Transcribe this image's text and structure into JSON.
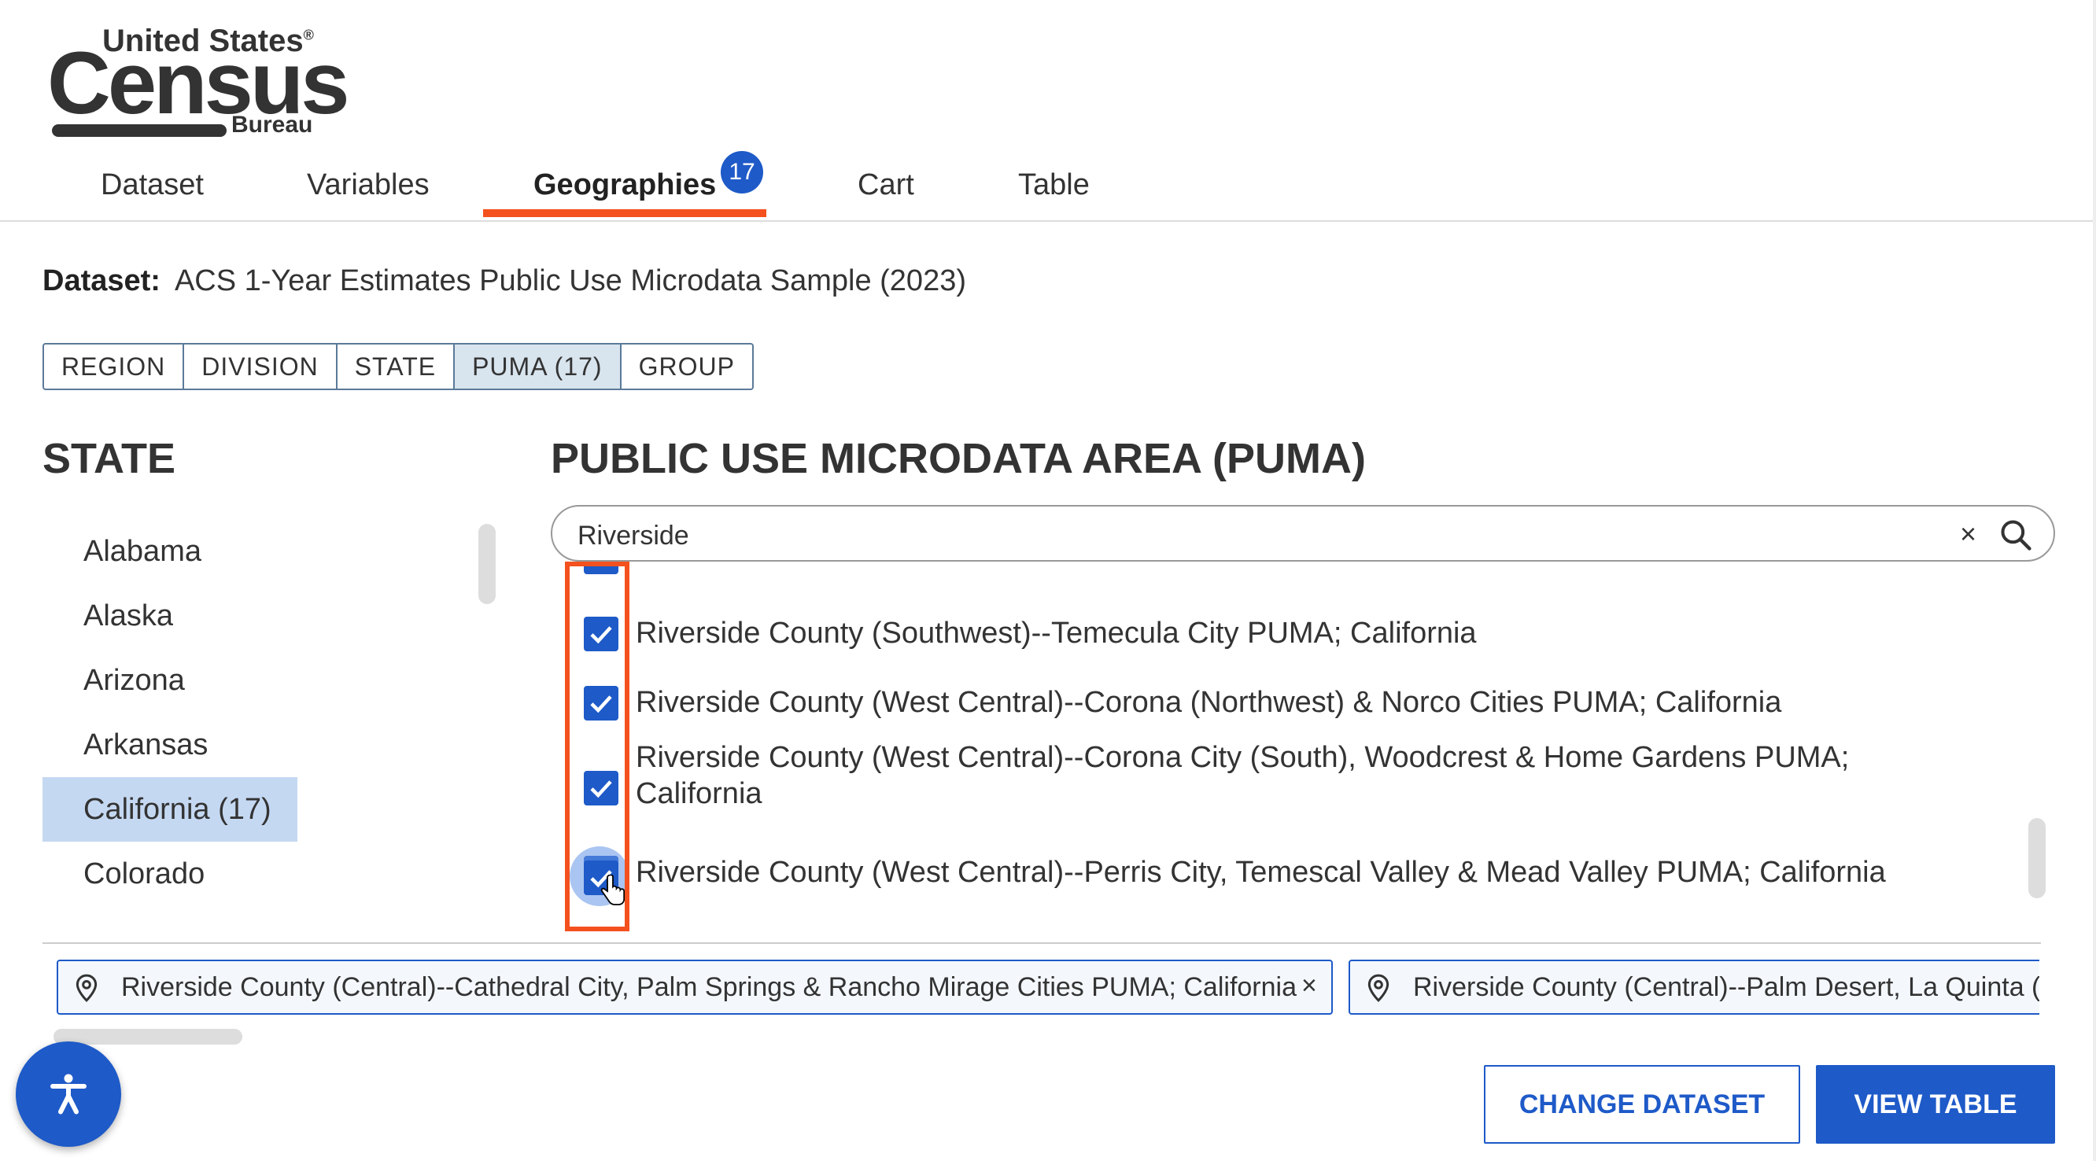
{
  "logo": {
    "line1": "United States",
    "line2": "Census",
    "line3": "Bureau",
    "reg": "®"
  },
  "tabs": [
    {
      "label": "Dataset"
    },
    {
      "label": "Variables"
    },
    {
      "label": "Geographies",
      "badge": "17",
      "active": true
    },
    {
      "label": "Cart"
    },
    {
      "label": "Table"
    }
  ],
  "dataset": {
    "label": "Dataset:",
    "value": "ACS 1-Year Estimates Public Use Microdata Sample (2023)"
  },
  "geo_levels": [
    "REGION",
    "DIVISION",
    "STATE",
    "PUMA (17)",
    "GROUP"
  ],
  "state_panel": {
    "heading": "STATE",
    "items": [
      "Alabama",
      "Alaska",
      "Arizona",
      "Arkansas",
      "California (17)",
      "Colorado"
    ],
    "selected": "California (17)"
  },
  "puma_panel": {
    "heading": "PUBLIC USE MICRODATA AREA (PUMA)",
    "search_value": "Riverside",
    "clear_glyph": "×",
    "results": [
      "Riverside County (Southwest)--Temecula City PUMA; California",
      "Riverside County (West Central)--Corona (Northwest) & Norco Cities PUMA; California",
      "Riverside County (West Central)--Corona City (South), Woodcrest & Home Gardens PUMA;",
      "California",
      "Riverside County (West Central)--Perris City, Temescal Valley & Mead Valley PUMA; California"
    ]
  },
  "selected_chips": [
    {
      "label": "Riverside County (Central)--Cathedral City, Palm Springs & Rancho Mirage Cities PUMA; California",
      "remove": "×"
    },
    {
      "label": "Riverside County (Central)--Palm Desert, La Quinta (W"
    }
  ],
  "buttons": {
    "change_dataset": "CHANGE DATASET",
    "view_table": "VIEW TABLE"
  },
  "colors": {
    "accent": "#1e5ac8",
    "tab_underline": "#f4511e",
    "highlight_box": "#f4511e",
    "selected_state_bg": "#c5d8f2"
  },
  "icons": [
    "search-icon",
    "close-icon",
    "check-icon",
    "location-pin-icon",
    "accessibility-icon",
    "hand-cursor-icon"
  ]
}
